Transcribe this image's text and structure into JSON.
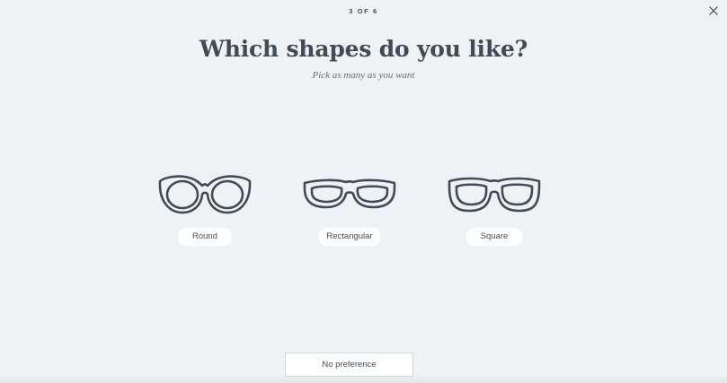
{
  "progress": {
    "label": "3 OF 6"
  },
  "header": {
    "title": "Which shapes do you like?",
    "subtitle": "Pick as many as you want"
  },
  "icons": {
    "close": "close-icon"
  },
  "options": [
    {
      "label": "Round",
      "icon": "round-glasses-icon"
    },
    {
      "label": "Rectangular",
      "icon": "rectangular-glasses-icon"
    },
    {
      "label": "Square",
      "icon": "square-glasses-icon"
    }
  ],
  "footer": {
    "no_preference_label": "No preference"
  },
  "colors": {
    "background": "#eff2f5",
    "text": "#414b56",
    "pill": "#ffffff",
    "button_border": "#c9d6e2"
  }
}
